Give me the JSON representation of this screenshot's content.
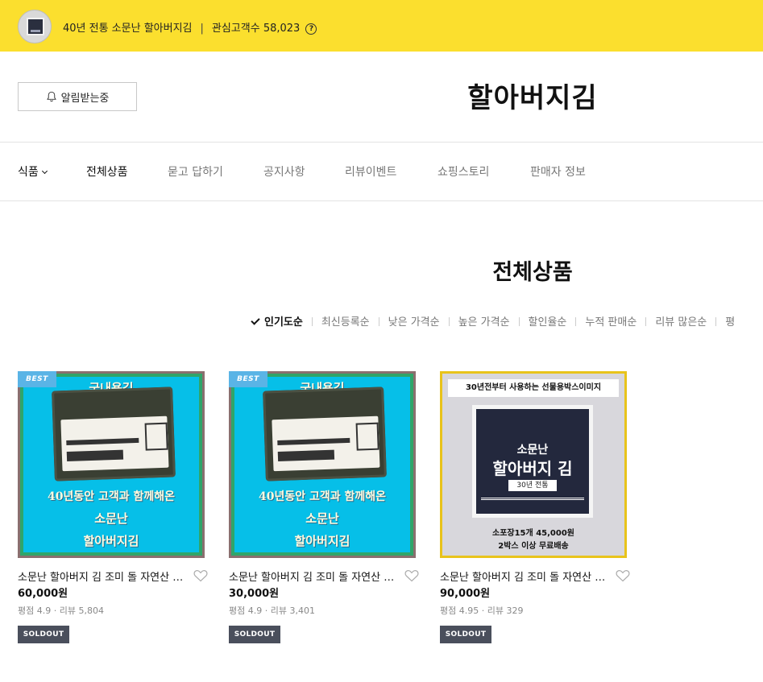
{
  "topbar": {
    "store_desc": "40년 전통 소문난 할아버지김",
    "separator": "|",
    "followers_label": "관심고객수 58,023",
    "help_icon": "?"
  },
  "header": {
    "notify_label": "알림받는중",
    "store_title": "할아버지김"
  },
  "nav": {
    "items": [
      {
        "label": "식품"
      },
      {
        "label": "전체상품"
      },
      {
        "label": "묻고 답하기"
      },
      {
        "label": "공지사항"
      },
      {
        "label": "리뷰이벤트"
      },
      {
        "label": "쇼핑스토리"
      },
      {
        "label": "판매자 정보"
      }
    ]
  },
  "section": {
    "title": "전체상품",
    "sort_options": [
      "인기도순",
      "최신등록순",
      "낮은 가격순",
      "높은 가격순",
      "할인율순",
      "누적 판매순",
      "리뷰 많은순",
      "평"
    ]
  },
  "products": [
    {
      "badge": "BEST",
      "image_text": {
        "top": "국내용김",
        "line1": "40년동안 고객과 함께해온",
        "line2": "소문난",
        "line3": "할아버지김"
      },
      "name": "소문난 할아버지 김 조미 돌 자연산 …",
      "price": "60,000원",
      "meta": "평점 4.9 · 리뷰 5,804",
      "status": "SOLDOUT"
    },
    {
      "badge": "BEST",
      "image_text": {
        "top": "국내용김",
        "line1": "40년동안 고객과 함께해온",
        "line2": "소문난",
        "line3": "할아버지김"
      },
      "name": "소문난 할아버지 김 조미 돌 자연산 …",
      "price": "30,000원",
      "meta": "평점 4.9 · 리뷰 3,401",
      "status": "SOLDOUT"
    },
    {
      "badge": "",
      "image_text": {
        "top": "30년전부터 사용하는 선물용박스이미지",
        "box1": "소문난",
        "box2": "할아버지 김",
        "box3": "30년 전통",
        "bottom1": "소포장15개 45,000원",
        "bottom2": "2박스 이상 무료배송"
      },
      "name": "소문난 할아버지 김 조미 돌 자연산 …",
      "price": "90,000원",
      "meta": "평점 4.95 · 리뷰 329",
      "status": "SOLDOUT"
    }
  ],
  "colors": {
    "topbar_bg": "#fbdf2e",
    "soldout_bg": "#4a4f5c",
    "best_badge": "#5ab4e6"
  }
}
